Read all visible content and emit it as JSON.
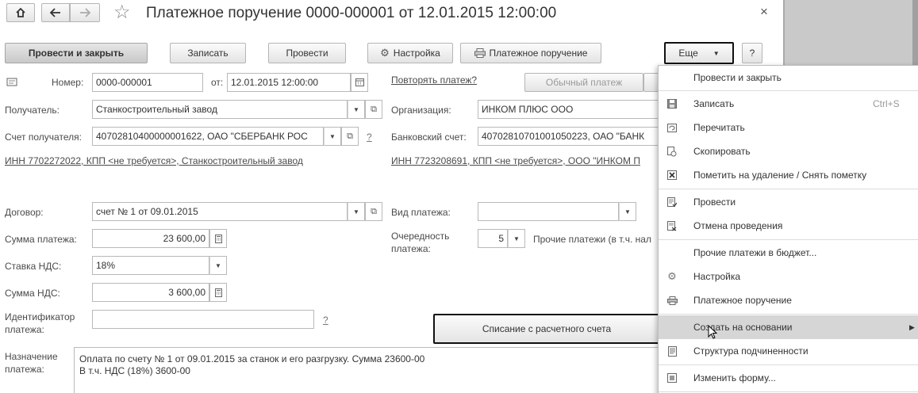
{
  "window": {
    "title": "Платежное поручение 0000-000001 от 12.01.2015 12:00:00",
    "home_icon": "home-icon",
    "back_icon": "arrow-left-icon",
    "forward_icon": "arrow-right-icon",
    "star_icon": "star-icon",
    "close_glyph": "×"
  },
  "toolbar": {
    "post_close": "Провести и закрыть",
    "save": "Записать",
    "post": "Провести",
    "settings": "Настройка",
    "print": "Платежное поручение",
    "more": "Еще",
    "help": "?"
  },
  "form": {
    "number_label": "Номер:",
    "number_value": "0000-000001",
    "date_label": "от:",
    "date_value": "12.01.2015 12:00:00",
    "repeat_link": "Повторять платеж?",
    "regular_payment": "Обычный платеж",
    "recipient_label": "Получатель:",
    "recipient_value": "Станкостроительный завод",
    "organization_label": "Организация:",
    "organization_value": "ИНКОМ ПЛЮС ООО",
    "recipient_account_label": "Счет получателя:",
    "recipient_account_value": "40702810400000001622, ОАО \"СБЕРБАНК РОС",
    "bank_account_label": "Банковский счет:",
    "bank_account_value": "40702810701001050223, ОАО \"БАНК",
    "recipient_inn_link": "ИНН 7702272022, КПП <не требуется>, Станкостроительный завод",
    "org_inn_link": "ИНН 7723208691, КПП <не требуется>, ООО \"ИНКОМ П",
    "contract_label": "Договор:",
    "contract_value": "счет № 1 от 09.01.2015",
    "payment_type_label": "Вид платежа:",
    "payment_type_value": "",
    "amount_label": "Сумма платежа:",
    "amount_value": "23 600,00",
    "priority_label_1": "Очередность",
    "priority_label_2": "платежа:",
    "priority_value": "5",
    "priority_desc": "Прочие платежи (в т.ч. нал",
    "vat_rate_label": "Ставка НДС:",
    "vat_rate_value": "18%",
    "vat_amount_label": "Сумма НДС:",
    "vat_amount_value": "3 600,00",
    "identifier_label_1": "Идентификатор",
    "identifier_label_2": "платежа:",
    "identifier_value": "",
    "question_mark": "?",
    "writeoff_button": "Списание с расчетного счета",
    "purpose_label_1": "Назначение",
    "purpose_label_2": "платежа:",
    "purpose_line_1": "Оплата по  счету № 1 от 09.01.2015 за станок и его разгрузку. Сумма 23600-00",
    "purpose_line_2": "В т.ч. НДС  (18%) 3600-00"
  },
  "menu": {
    "items": [
      {
        "label": "Провести и закрыть",
        "icon": ""
      },
      {
        "label": "Записать",
        "icon": "save-icon",
        "shortcut": "Ctrl+S"
      },
      {
        "label": "Перечитать",
        "icon": "reread-icon"
      },
      {
        "label": "Скопировать",
        "icon": "copy-icon"
      },
      {
        "label": "Пометить на удаление / Снять пометку",
        "icon": "delete-mark-icon"
      },
      {
        "label": "Провести",
        "icon": "post-icon"
      },
      {
        "label": "Отмена проведения",
        "icon": "unpost-icon"
      },
      {
        "label": "Прочие платежи в бюджет...",
        "icon": ""
      },
      {
        "label": "Настройка",
        "icon": "gear-icon"
      },
      {
        "label": "Платежное поручение",
        "icon": "printer-icon"
      },
      {
        "label": "Создать на основании",
        "icon": ""
      },
      {
        "label": "Структура подчиненности",
        "icon": "structure-icon"
      },
      {
        "label": "Изменить форму...",
        "icon": "form-icon"
      }
    ]
  }
}
